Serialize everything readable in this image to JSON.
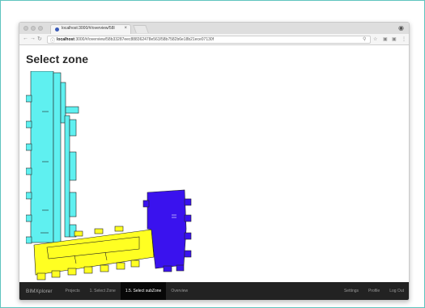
{
  "browser": {
    "tab_title": "localhost:3000/#/overview/58l",
    "tab_close": "×",
    "url_host": "localhost",
    "url_rest": ":3000/#/overview/58b33287eec888362478e563/58b7582b6e18b21ece07130f"
  },
  "page": {
    "title": "Select zone"
  },
  "navbar": {
    "brand": "BIMXplorer",
    "left_items": [
      "Projects",
      "1. Select Zone",
      "1.5. Select subZone",
      "Overview"
    ],
    "active_item": "1.5. Select subZone",
    "right_items": [
      "Settings",
      "Profile",
      "Log Out"
    ]
  },
  "colors": {
    "zone_cyan": "#5ff0f0",
    "zone_yellow": "#ffff22",
    "zone_blue": "#3a12ee",
    "navbar_bg": "#222222"
  },
  "icons": [
    "back-icon",
    "forward-icon",
    "reload-icon",
    "info-icon",
    "key-icon",
    "star-icon",
    "extension-icon",
    "menu-icon",
    "profile-icon"
  ]
}
